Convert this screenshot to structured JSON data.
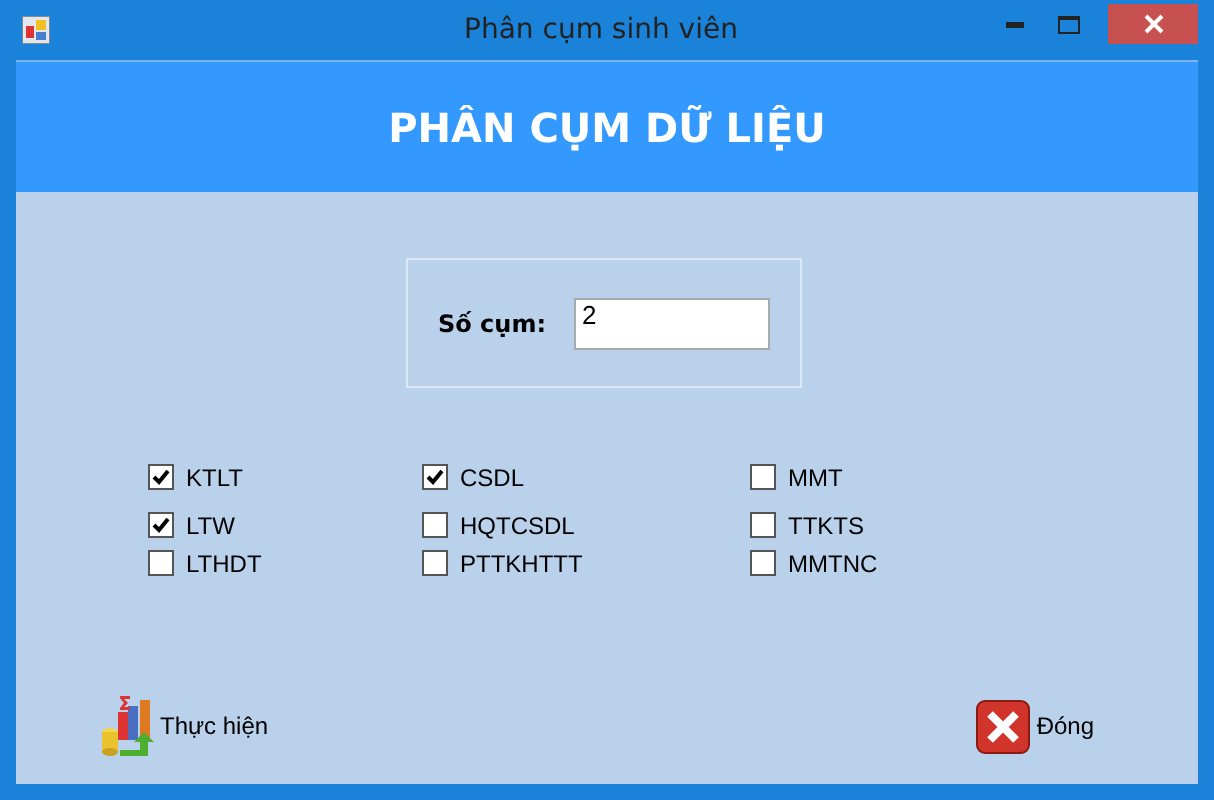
{
  "window": {
    "title": "Phân cụm sinh viên"
  },
  "header": "PHÂN CỤM DỮ LIỆU",
  "cluster_count": {
    "label": "Số cụm:",
    "value": "2"
  },
  "subjects": [
    {
      "label": "KTLT",
      "checked": true
    },
    {
      "label": "CSDL",
      "checked": true
    },
    {
      "label": "MMT",
      "checked": false
    },
    {
      "label": "LTW",
      "checked": true
    },
    {
      "label": "HQTCSDL",
      "checked": false
    },
    {
      "label": "TTKTS",
      "checked": false
    },
    {
      "label": "LTHDT",
      "checked": false
    },
    {
      "label": "PTTKHTTT",
      "checked": false
    },
    {
      "label": "MMTNC",
      "checked": false
    }
  ],
  "buttons": [
    {
      "kind": "run",
      "label": "Thực hiện"
    },
    {
      "kind": "close",
      "label": "Đóng"
    }
  ]
}
